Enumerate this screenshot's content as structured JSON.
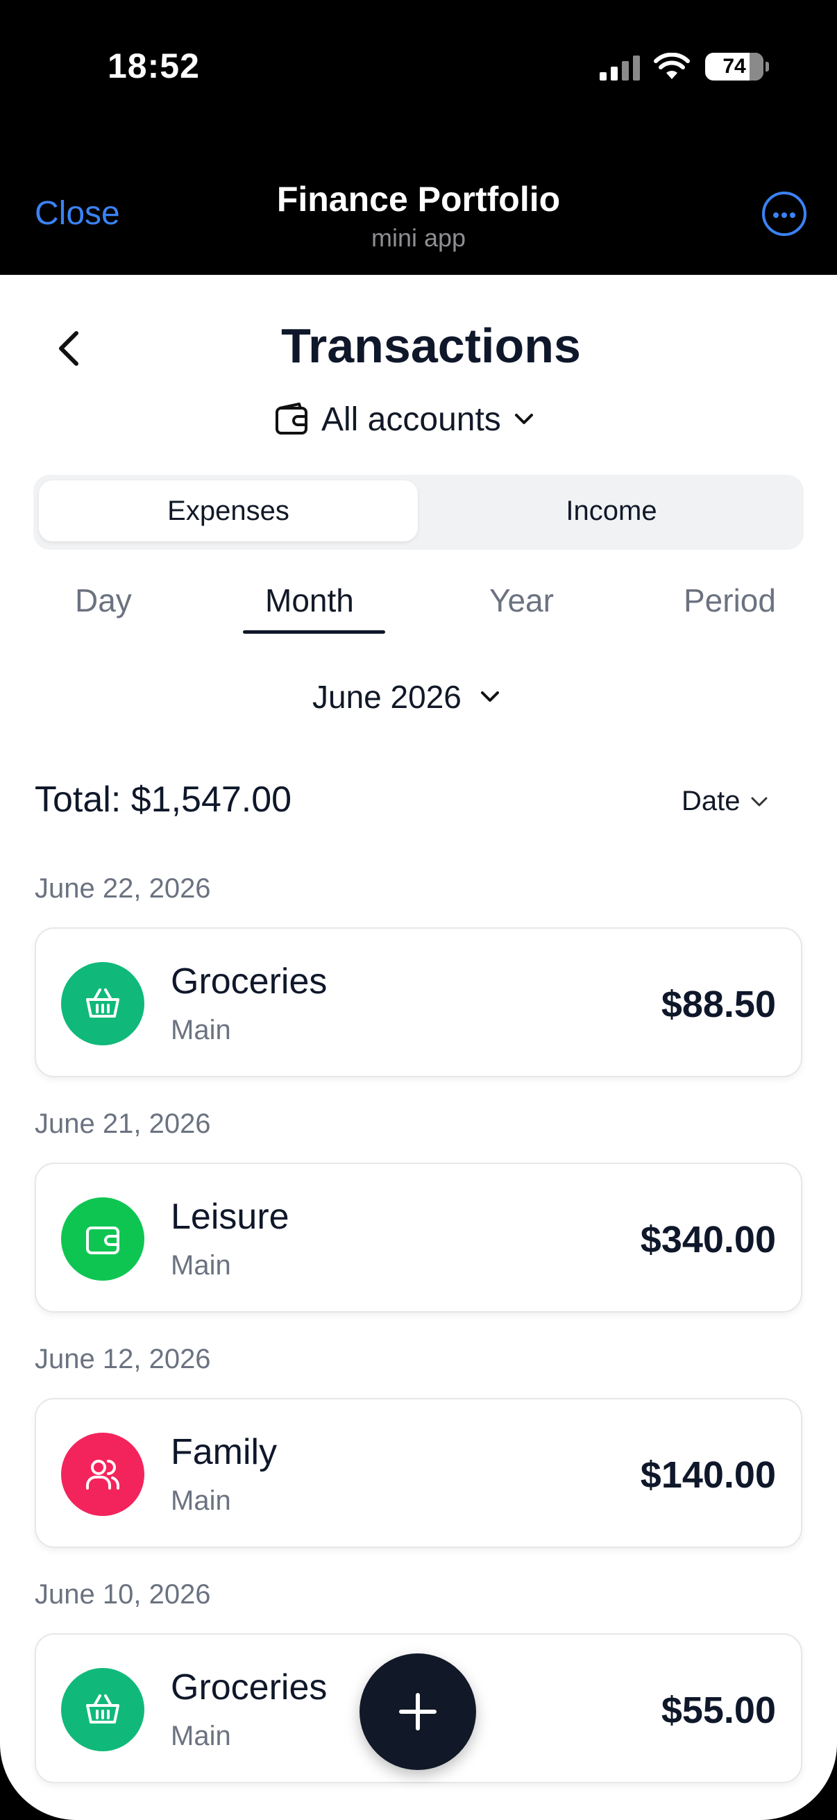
{
  "status_bar": {
    "time": "18:52",
    "battery": "74",
    "icons": [
      "cellular-signal-icon",
      "wifi-icon",
      "battery-icon"
    ]
  },
  "mini_app": {
    "close_label": "Close",
    "title": "Finance Portfolio",
    "subtitle": "mini app",
    "more_icon": "more-horizontal-icon"
  },
  "page": {
    "title": "Transactions",
    "account_selector": "All accounts"
  },
  "type_toggle": {
    "options": [
      "Expenses",
      "Income"
    ],
    "selected": "Expenses"
  },
  "period_tabs": {
    "tabs": [
      "Day",
      "Month",
      "Year",
      "Period"
    ],
    "selected": "Month"
  },
  "month_selector": "June 2026",
  "summary": {
    "total": "Total: $1,547.00",
    "sort_label": "Date"
  },
  "groups": [
    {
      "date": "June 22, 2026",
      "transactions": [
        {
          "name": "Groceries",
          "account": "Main",
          "amount": "$88.50",
          "icon": "basket-icon",
          "color": "#10b97a"
        }
      ]
    },
    {
      "date": "June 21, 2026",
      "transactions": [
        {
          "name": "Leisure",
          "account": "Main",
          "amount": "$340.00",
          "icon": "wallet-icon",
          "color": "#0fc552"
        }
      ]
    },
    {
      "date": "June 12, 2026",
      "transactions": [
        {
          "name": "Family",
          "account": "Main",
          "amount": "$140.00",
          "icon": "users-icon",
          "color": "#f3245c"
        }
      ]
    },
    {
      "date": "June 10, 2026",
      "transactions": [
        {
          "name": "Groceries",
          "account": "Main",
          "amount": "$55.00",
          "icon": "basket-icon",
          "color": "#10b97a"
        }
      ]
    }
  ],
  "fab": {
    "icon": "plus-icon"
  }
}
